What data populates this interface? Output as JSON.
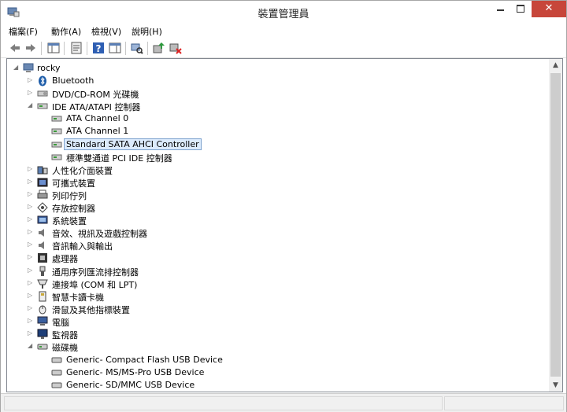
{
  "window": {
    "title": "裝置管理員",
    "close_glyph": "✕"
  },
  "menu": [
    {
      "label": "檔案(F)",
      "icon": ""
    },
    {
      "label": "動作(A)",
      "icon": ""
    },
    {
      "label": "檢視(V)",
      "icon": ""
    },
    {
      "label": "說明(H)",
      "icon": ""
    }
  ],
  "toolbar": [
    "back-icon",
    "forward-icon",
    "properties-icon",
    "show-hide-console-tree-icon",
    "help-icon",
    "action-pane-icon",
    "scan-hardware-icon",
    "update-driver-icon",
    "uninstall-device-icon"
  ],
  "tree": {
    "root": "rocky",
    "items": [
      {
        "label": "Bluetooth",
        "icon": "bluetooth-icon"
      },
      {
        "label": "DVD/CD-ROM 光碟機",
        "icon": "dvd-drive-icon"
      },
      {
        "label": "IDE ATA/ATAPI 控制器",
        "icon": "ide-controller-icon",
        "expanded": true,
        "children": [
          {
            "label": "ATA Channel 0"
          },
          {
            "label": "ATA Channel 1"
          },
          {
            "label": "Standard SATA AHCI Controller",
            "selected": true
          },
          {
            "label": "標準雙通道 PCI IDE 控制器"
          }
        ]
      },
      {
        "label": "人性化介面裝置",
        "icon": "hid-icon"
      },
      {
        "label": "可攜式裝置",
        "icon": "portable-device-icon"
      },
      {
        "label": "列印佇列",
        "icon": "print-queue-icon"
      },
      {
        "label": "存放控制器",
        "icon": "storage-controller-icon"
      },
      {
        "label": "系統裝置",
        "icon": "system-device-icon"
      },
      {
        "label": "音效、視訊及遊戲控制器",
        "icon": "sound-icon"
      },
      {
        "label": "音訊輸入與輸出",
        "icon": "audio-io-icon"
      },
      {
        "label": "處理器",
        "icon": "processor-icon"
      },
      {
        "label": "通用序列匯流排控制器",
        "icon": "usb-controller-icon"
      },
      {
        "label": "連接埠 (COM 和 LPT)",
        "icon": "port-icon"
      },
      {
        "label": "智慧卡讀卡機",
        "icon": "smartcard-reader-icon"
      },
      {
        "label": "滑鼠及其他指標裝置",
        "icon": "mouse-icon"
      },
      {
        "label": "電腦",
        "icon": "computer-icon"
      },
      {
        "label": "監視器",
        "icon": "monitor-icon"
      },
      {
        "label": "磁碟機",
        "icon": "disk-drive-icon",
        "expanded": true,
        "children": [
          {
            "label": "Generic- Compact Flash USB Device"
          },
          {
            "label": "Generic- MS/MS-Pro USB Device"
          },
          {
            "label": "Generic- SD/MMC USB Device"
          }
        ]
      }
    ]
  },
  "scroll": {
    "position": 0.0,
    "up_glyph": "▲",
    "down_glyph": "▼"
  },
  "colors": {
    "selection_bg": "#dcebfc",
    "selection_border": "#7da2ce",
    "close_button": "#c7463a"
  }
}
